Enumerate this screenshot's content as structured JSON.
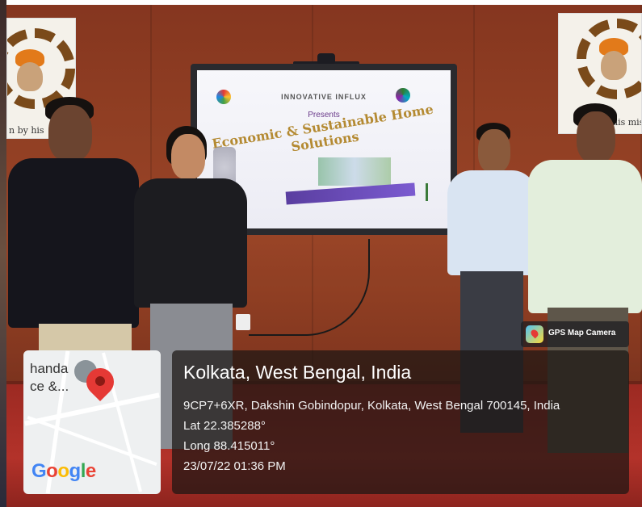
{
  "tv": {
    "brand": "INNOVATIVE INFLUX",
    "presents": "Presents",
    "headline": "Economic & Sustainable Home Solutions"
  },
  "posters": {
    "left_text": "n by his",
    "right_text": "his mis"
  },
  "map": {
    "text": "handa\nce &...",
    "logo": "Google",
    "logo_colors": [
      "#4285F4",
      "#EA4335",
      "#FBBC05",
      "#4285F4",
      "#34A853",
      "#EA4335"
    ]
  },
  "gps_badge": {
    "label": "GPS Map Camera"
  },
  "location": {
    "title": "Kolkata, West Bengal, India",
    "address": "9CP7+6XR, Dakshin Gobindopur, Kolkata, West Bengal 700145, India",
    "lat": "Lat 22.385288°",
    "long": "Long 88.415011°",
    "timestamp": "23/07/22 01:36 PM"
  }
}
